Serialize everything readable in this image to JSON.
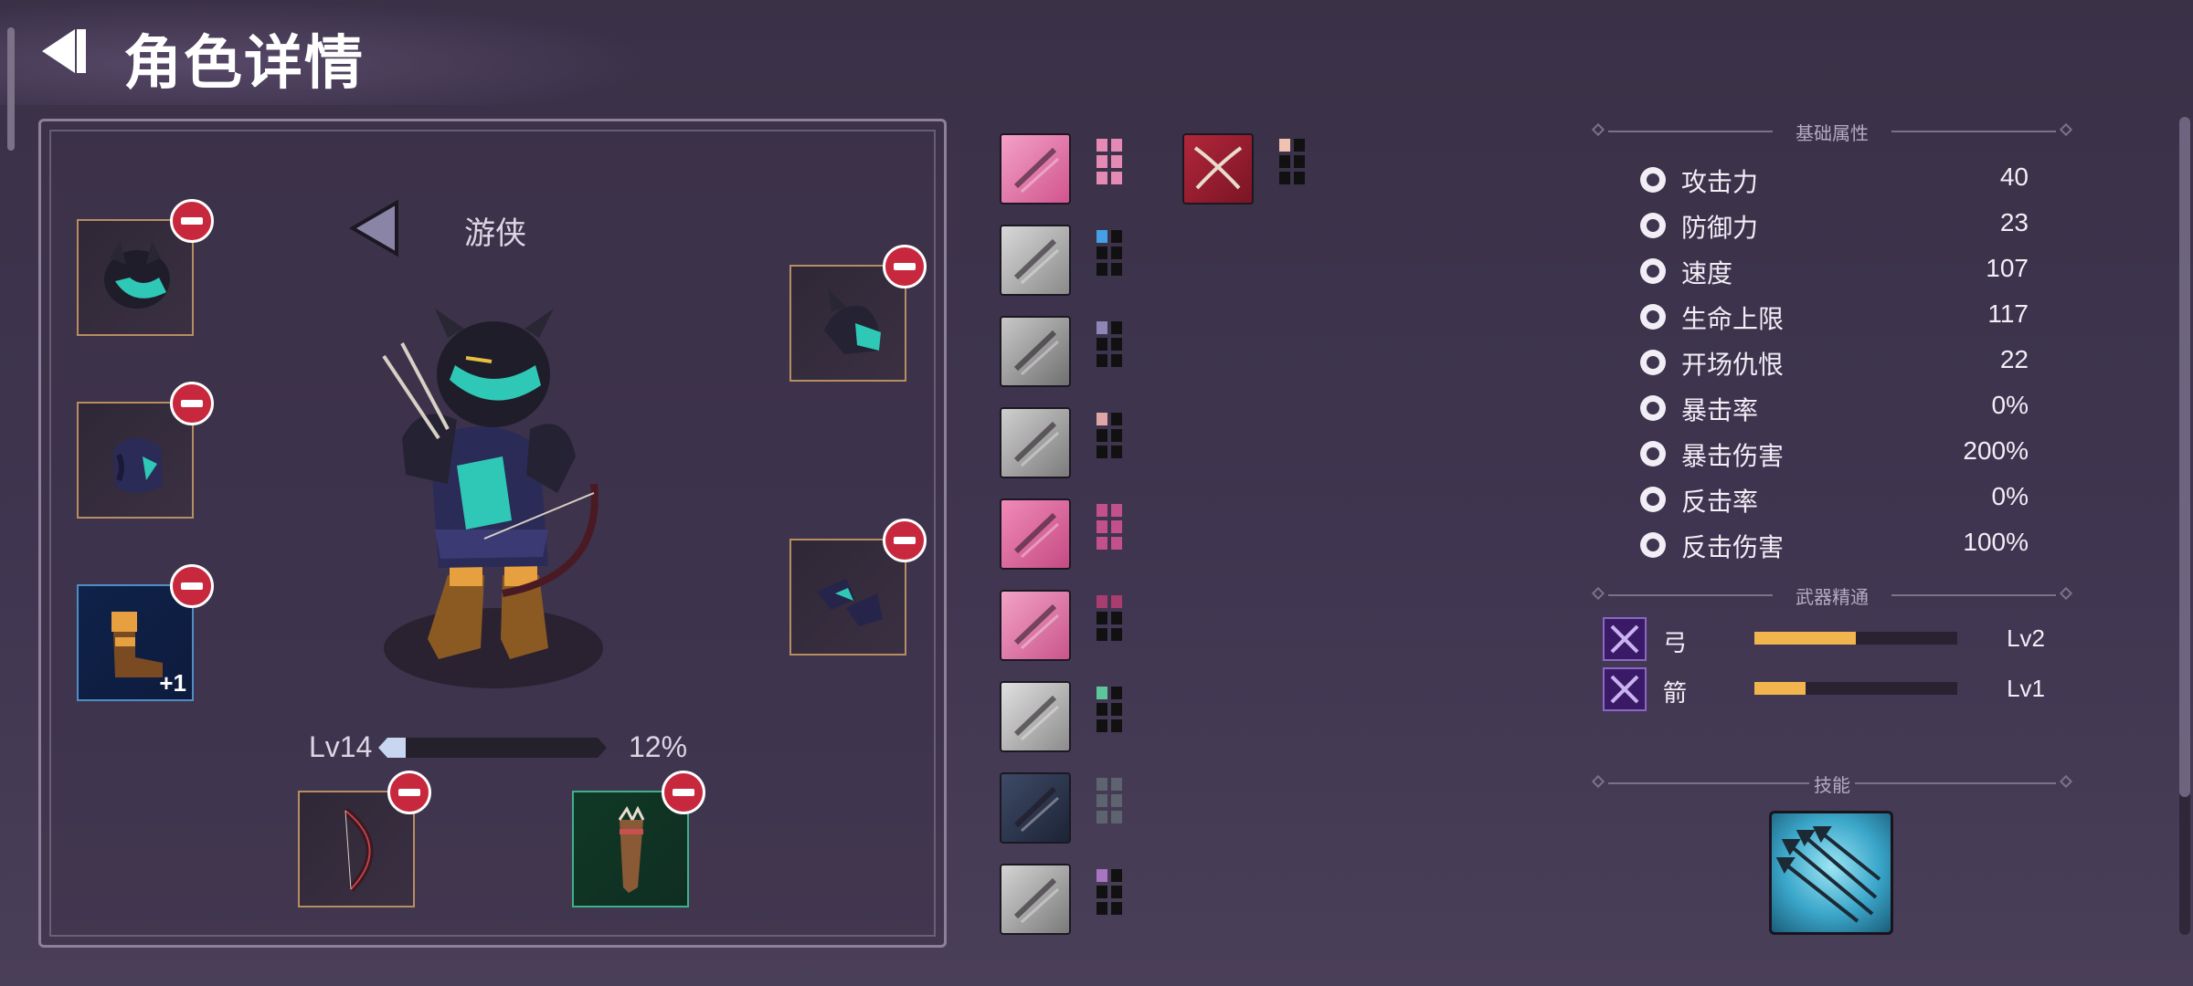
{
  "header": {
    "title": "角色详情"
  },
  "character": {
    "class_name": "游侠",
    "level_label": "Lv14",
    "xp_percent_text": "12%",
    "xp_progress": 0.12,
    "slots": [
      {
        "name": "helmet",
        "badge": ""
      },
      {
        "name": "armor",
        "badge": ""
      },
      {
        "name": "boots",
        "badge": "+1"
      },
      {
        "name": "shoulder",
        "badge": ""
      },
      {
        "name": "gloves",
        "badge": ""
      },
      {
        "name": "bow",
        "badge": ""
      },
      {
        "name": "quiver",
        "badge": ""
      }
    ]
  },
  "trait_icons": [
    {
      "icon": "boot-icon",
      "pip_color": "#e58ab5",
      "filled": 6
    },
    {
      "icon": "plate-icon",
      "pip_color": "#45a0e6",
      "filled": 1
    },
    {
      "icon": "soldiers-icon",
      "pip_color": "#8f86b8",
      "filled": 1
    },
    {
      "icon": "daggers-icon",
      "pip_color": "#e0a6a6",
      "filled": 1
    },
    {
      "icon": "claw-icon",
      "pip_color": "#c2508a",
      "filled": 6
    },
    {
      "icon": "cross-swords-icon",
      "pip_color": "#a83d6f",
      "filled": 2
    },
    {
      "icon": "eye-icon",
      "pip_color": "#5cc79b",
      "filled": 1
    },
    {
      "icon": "lamp-icon",
      "pip_color": "#5d6470",
      "filled": 0
    },
    {
      "icon": "fist-icon",
      "pip_color": "#a775c2",
      "filled": 1
    }
  ],
  "extra_trait": {
    "icon": "crossed-sabres-icon",
    "pip_color": "#f0c2b0",
    "filled": 1
  },
  "stats": {
    "heading": "基础属性",
    "rows": [
      {
        "icon": "sword-icon",
        "label": "攻击力",
        "value": "40"
      },
      {
        "icon": "shield-icon",
        "label": "防御力",
        "value": "23"
      },
      {
        "icon": "boot-speed-icon",
        "label": "速度",
        "value": "107"
      },
      {
        "icon": "heart-icon",
        "label": "生命上限",
        "value": "117"
      },
      {
        "icon": "skull-icon",
        "label": "开场仇恨",
        "value": "22"
      },
      {
        "icon": "crit-icon",
        "label": "暴击率",
        "value": "0%"
      },
      {
        "icon": "crit-damage-icon",
        "label": "暴击伤害",
        "value": "200%"
      },
      {
        "icon": "counter-icon",
        "label": "反击率",
        "value": "0%"
      },
      {
        "icon": "counter-damage-icon",
        "label": "反击伤害",
        "value": "100%"
      }
    ]
  },
  "weapon_mastery": {
    "heading": "武器精通",
    "rows": [
      {
        "icon": "bow-mastery-icon",
        "label": "弓",
        "level": "Lv2",
        "progress": 0.5
      },
      {
        "icon": "arrow-mastery-icon",
        "label": "箭",
        "level": "Lv1",
        "progress": 0.25
      }
    ]
  },
  "skills": {
    "heading": "技能",
    "icon": "arrow-volley-icon"
  }
}
